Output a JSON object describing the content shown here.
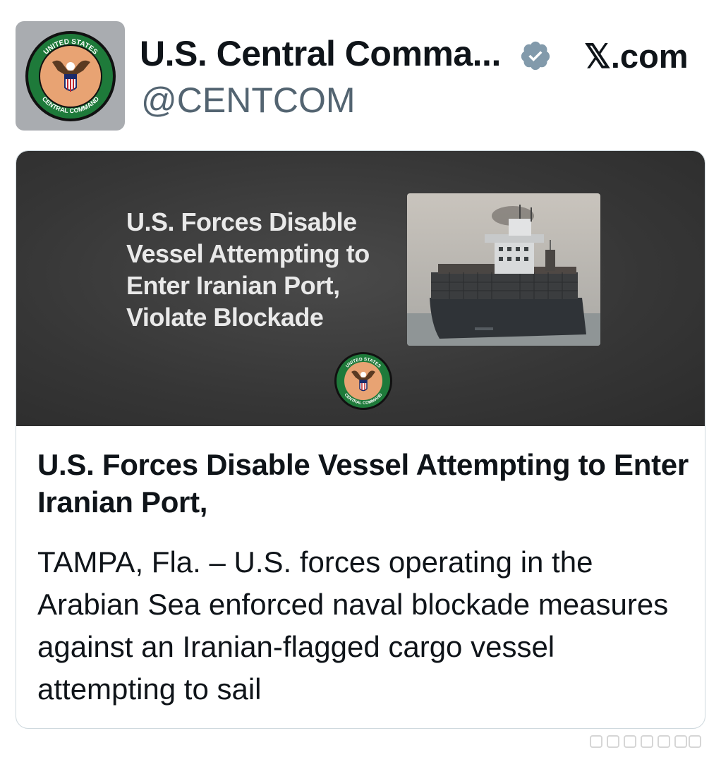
{
  "header": {
    "display_name": "U.S. Central Comma...",
    "handle": "@CENTCOM",
    "source": "𝕏.com",
    "verified_icon": "verified-badge-icon",
    "avatar_icon": "centcom-seal-icon"
  },
  "card": {
    "banner_title": "U.S. Forces Disable Vessel Attempting to Enter Iranian Port, Violate Blockade",
    "banner_image": "cargo-ship-photo",
    "banner_seal": "centcom-seal-icon",
    "headline": "U.S. Forces Disable Vessel Attempting to Enter Iranian Port,",
    "body": "TAMPA, Fla. – U.S. forces operating in the Arabian Sea enforced naval blockade measures against an Iranian-flagged cargo vessel attempting to sail"
  },
  "seal": {
    "top_text": "UNITED STATES",
    "bottom_text": "CENTRAL COMMAND"
  },
  "colors": {
    "verified": "#829aab",
    "banner_bg": "#363636",
    "seal_ring": "#1e7a3a"
  }
}
